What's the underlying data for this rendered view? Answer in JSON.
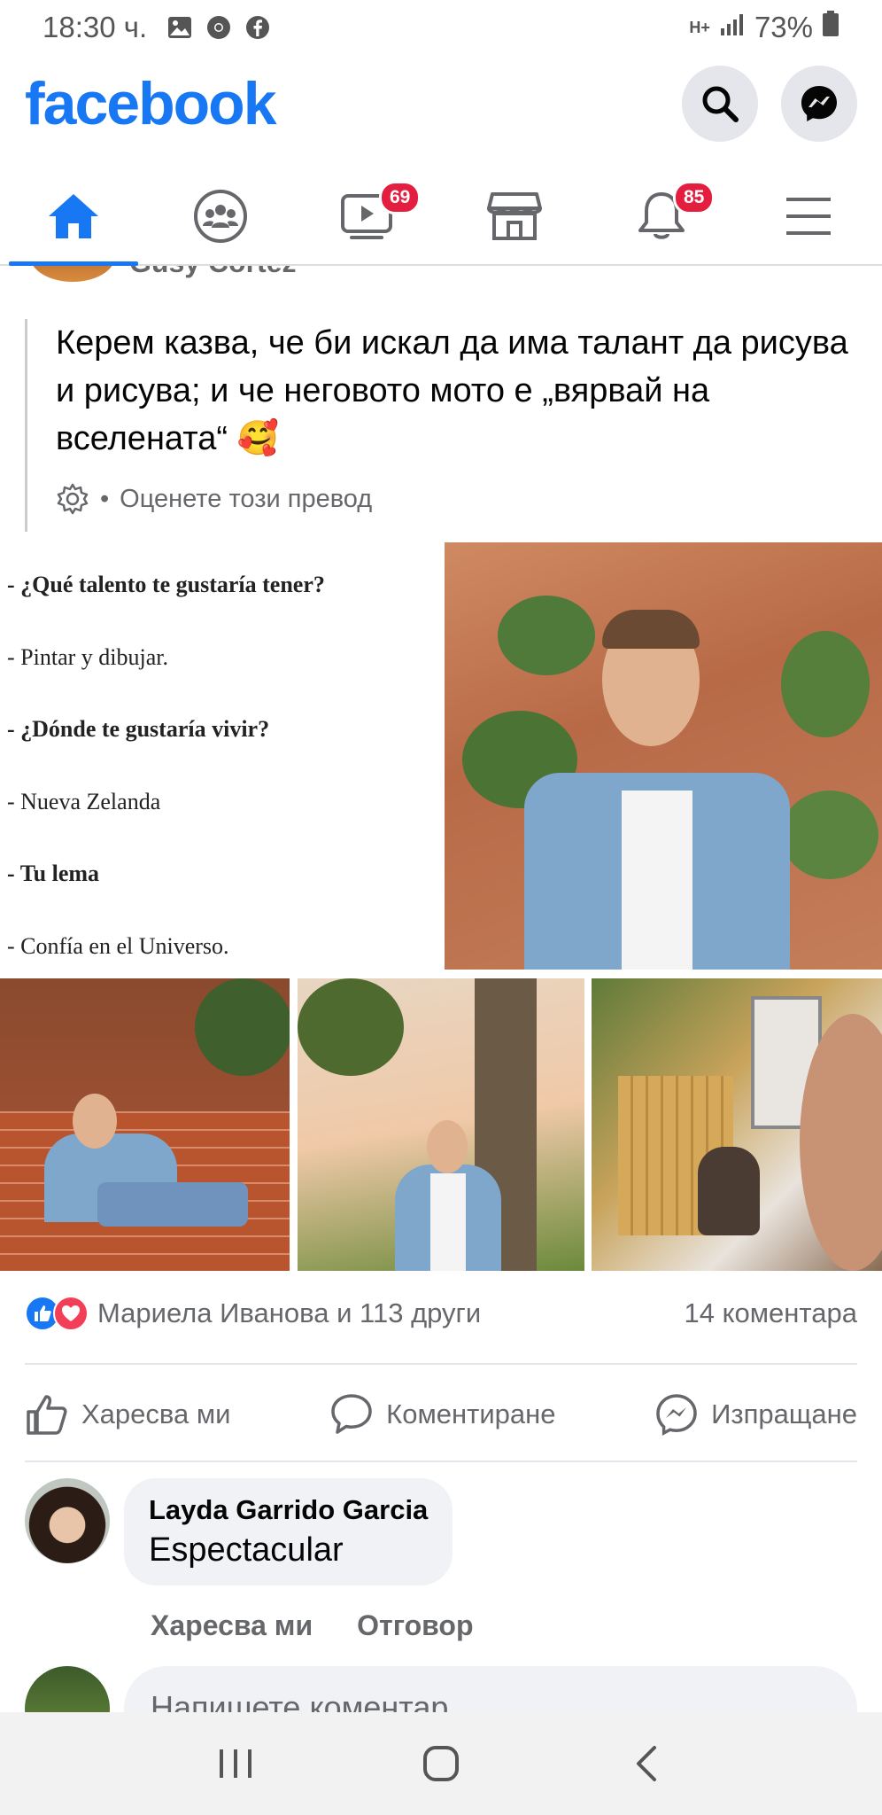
{
  "status_bar": {
    "time": "18:30 ч.",
    "network": "H+",
    "battery": "73%"
  },
  "header": {
    "logo": "facebook",
    "search_icon": "search-icon",
    "messenger_icon": "messenger-icon"
  },
  "tabs": [
    {
      "name": "home",
      "badge": ""
    },
    {
      "name": "groups",
      "badge": ""
    },
    {
      "name": "watch",
      "badge": "69"
    },
    {
      "name": "marketplace",
      "badge": ""
    },
    {
      "name": "notifications",
      "badge": "85"
    },
    {
      "name": "menu",
      "badge": ""
    }
  ],
  "post": {
    "author_partial": "Gusy Cortez",
    "text": "Керем казва, че би искал да има талант да рисува и рисува; и че неговото мото е „вярвай на вселената“ 🥰",
    "translate_rate": "Оценете този превод",
    "image_text": [
      "- ¿Qué talento te gustaría tener?",
      "- Pintar y dibujar.",
      "- ¿Dónde te gustaría vivir?",
      "- Nueva Zelanda",
      "- Tu lema",
      "- Confía en el Universo."
    ],
    "reactions_text": "Мариела Иванова и 113 други",
    "comments_count": "14 коментара",
    "actions": {
      "like": "Харесва ми",
      "comment": "Коментиране",
      "share": "Изпращане"
    }
  },
  "comment": {
    "author": "Layda Garrido Garcia",
    "text": "Espectacular",
    "like": "Харесва ми",
    "reply": "Отговор"
  },
  "write_comment": {
    "placeholder": "Напишете коментар..."
  },
  "colors": {
    "brand": "#1877f2",
    "badge": "#e41e3f",
    "love": "#f33e58"
  }
}
